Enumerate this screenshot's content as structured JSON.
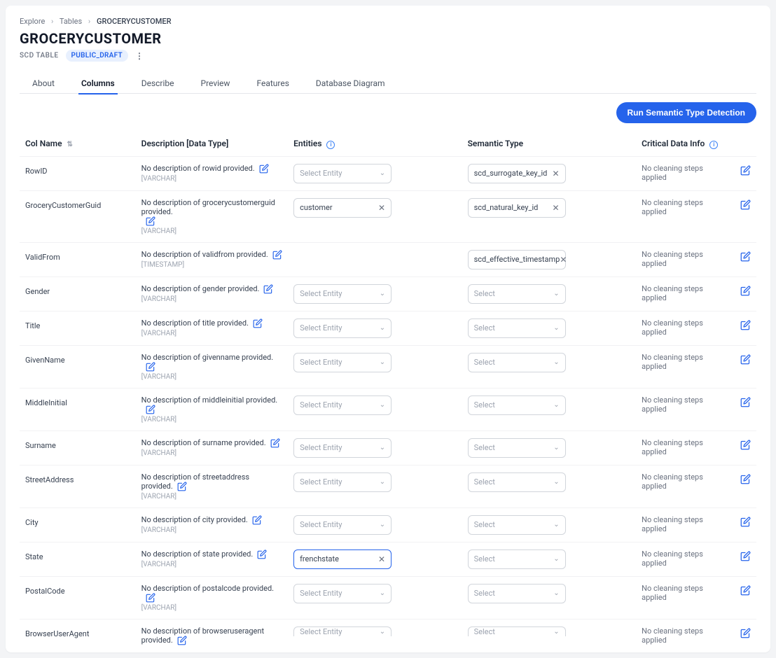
{
  "breadcrumb": {
    "explore": "Explore",
    "tables": "Tables",
    "current": "GROCERYCUSTOMER"
  },
  "title": "GROCERYCUSTOMER",
  "scd_label": "SCD TABLE",
  "status_badge": "PUBLIC_DRAFT",
  "tabs": {
    "about": "About",
    "columns": "Columns",
    "describe": "Describe",
    "preview": "Preview",
    "features": "Features",
    "diagram": "Database Diagram"
  },
  "action_button": "Run Semantic Type Detection",
  "headers": {
    "col_name": "Col Name",
    "description": "Description [Data Type]",
    "entities": "Entities",
    "semantic_type": "Semantic Type",
    "critical": "Critical Data Info"
  },
  "placeholders": {
    "select_entity": "Select Entity",
    "select": "Select"
  },
  "cleaning_default": "No cleaning steps applied",
  "rows": [
    {
      "name": "RowID",
      "desc": "No description of rowid provided.",
      "dtype": "[VARCHAR]",
      "entity": "",
      "entity_hidden": false,
      "semantic": "scd_surrogate_key_id",
      "semantic_hidden": false
    },
    {
      "name": "GroceryCustomerGuid",
      "desc": "No description of grocerycustomerguid provided.",
      "dtype": "[VARCHAR]",
      "desc_edit_below": true,
      "entity": "customer",
      "semantic": "scd_natural_key_id"
    },
    {
      "name": "ValidFrom",
      "desc": "No description of validfrom provided.",
      "dtype": "[TIMESTAMP]",
      "entity_hidden": true,
      "semantic": "scd_effective_timestamp"
    },
    {
      "name": "Gender",
      "desc": "No description of gender provided.",
      "dtype": "[VARCHAR]",
      "entity": "",
      "semantic": ""
    },
    {
      "name": "Title",
      "desc": "No description of title provided.",
      "dtype": "[VARCHAR]",
      "entity": "",
      "semantic": ""
    },
    {
      "name": "GivenName",
      "desc": "No description of givenname provided.",
      "dtype": "[VARCHAR]",
      "entity": "",
      "semantic": ""
    },
    {
      "name": "MiddleInitial",
      "desc": "No description of middleinitial provided.",
      "dtype": "[VARCHAR]",
      "entity": "",
      "semantic": ""
    },
    {
      "name": "Surname",
      "desc": "No description of surname provided.",
      "dtype": "[VARCHAR]",
      "entity": "",
      "semantic": ""
    },
    {
      "name": "StreetAddress",
      "desc": "No description of streetaddress provided.",
      "dtype": "[VARCHAR]",
      "entity": "",
      "semantic": ""
    },
    {
      "name": "City",
      "desc": "No description of city provided.",
      "dtype": "[VARCHAR]",
      "entity": "",
      "semantic": ""
    },
    {
      "name": "State",
      "desc": "No description of state provided.",
      "dtype": "[VARCHAR]",
      "entity": "frenchstate",
      "entity_highlight": true,
      "semantic": ""
    },
    {
      "name": "PostalCode",
      "desc": "No description of postalcode provided.",
      "dtype": "[VARCHAR]",
      "entity": "",
      "semantic": ""
    },
    {
      "name": "BrowserUserAgent",
      "desc": "No description of browseruseragent provided.",
      "dtype": "",
      "entity": "",
      "entity_partial": true,
      "semantic": "",
      "semantic_partial": true
    }
  ]
}
